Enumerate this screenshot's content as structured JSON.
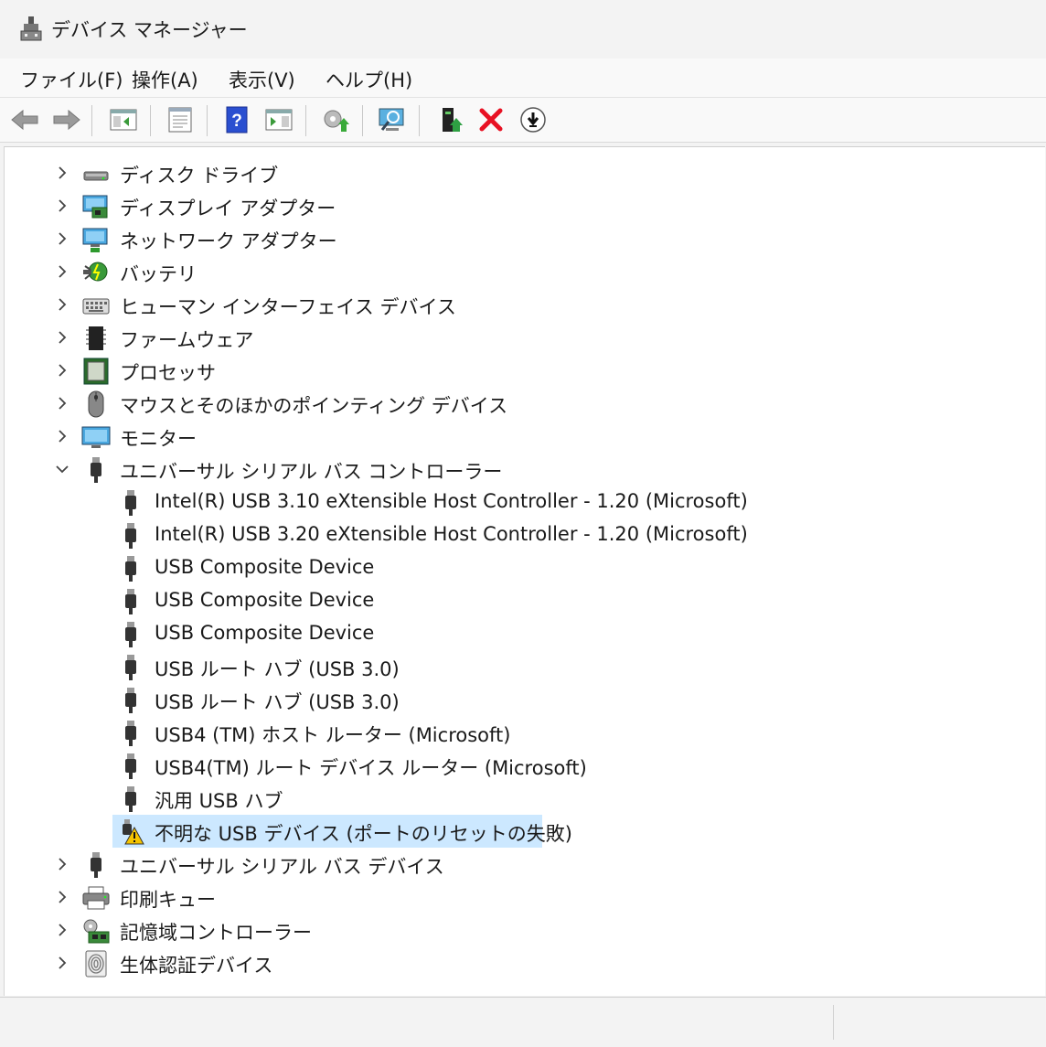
{
  "window": {
    "title": "デバイス マネージャー"
  },
  "menu": [
    {
      "label": "ファイル(F)"
    },
    {
      "label": "操作(A)"
    },
    {
      "label": "表示(V)"
    },
    {
      "label": "ヘルプ(H)"
    }
  ],
  "toolbar": {
    "buttons": [
      "back-icon",
      "forward-icon",
      "show-hide-console-tree-icon",
      "properties-icon",
      "help-icon",
      "action-pane-icon",
      "update-driver-icon",
      "scan-hardware-icon",
      "enable-device-icon",
      "uninstall-device-icon",
      "disable-device-icon"
    ]
  },
  "tree": {
    "categories_before": [
      {
        "label": "ディスク ドライブ",
        "icon": "disk-drive-icon"
      },
      {
        "label": "ディスプレイ アダプター",
        "icon": "display-adapter-icon"
      },
      {
        "label": "ネットワーク アダプター",
        "icon": "network-adapter-icon"
      },
      {
        "label": "バッテリ",
        "icon": "battery-icon"
      },
      {
        "label": "ヒューマン インターフェイス デバイス",
        "icon": "hid-icon"
      },
      {
        "label": "ファームウェア",
        "icon": "firmware-icon"
      },
      {
        "label": "プロセッサ",
        "icon": "processor-icon"
      },
      {
        "label": "マウスとそのほかのポインティング デバイス",
        "icon": "mouse-icon"
      },
      {
        "label": "モニター",
        "icon": "monitor-icon"
      }
    ],
    "expanded": {
      "label": "ユニバーサル シリアル バス コントローラー",
      "icon": "usb-icon",
      "children": [
        {
          "label": "Intel(R) USB 3.10 eXtensible Host Controller - 1.20 (Microsoft)"
        },
        {
          "label": "Intel(R) USB 3.20 eXtensible Host Controller - 1.20 (Microsoft)"
        },
        {
          "label": "USB Composite Device"
        },
        {
          "label": "USB Composite Device"
        },
        {
          "label": "USB Composite Device"
        },
        {
          "label": "USB ルート ハブ (USB 3.0)"
        },
        {
          "label": "USB ルート ハブ (USB 3.0)"
        },
        {
          "label": "USB4 (TM) ホスト ルーター (Microsoft)"
        },
        {
          "label": "USB4(TM) ルート デバイス ルーター (Microsoft)"
        },
        {
          "label": "汎用 USB ハブ"
        },
        {
          "label": "不明な USB デバイス (ポートのリセットの失敗)",
          "warning": true,
          "selected": true
        }
      ]
    },
    "categories_after": [
      {
        "label": "ユニバーサル シリアル バス デバイス",
        "icon": "usb-icon"
      },
      {
        "label": "印刷キュー",
        "icon": "printer-icon"
      },
      {
        "label": "記憶域コントローラー",
        "icon": "storage-controller-icon"
      },
      {
        "label": "生体認証デバイス",
        "icon": "biometric-icon"
      }
    ]
  },
  "colors": {
    "selection": "#cce8ff",
    "warning": "#f5c400",
    "uninstall": "#e81123"
  }
}
